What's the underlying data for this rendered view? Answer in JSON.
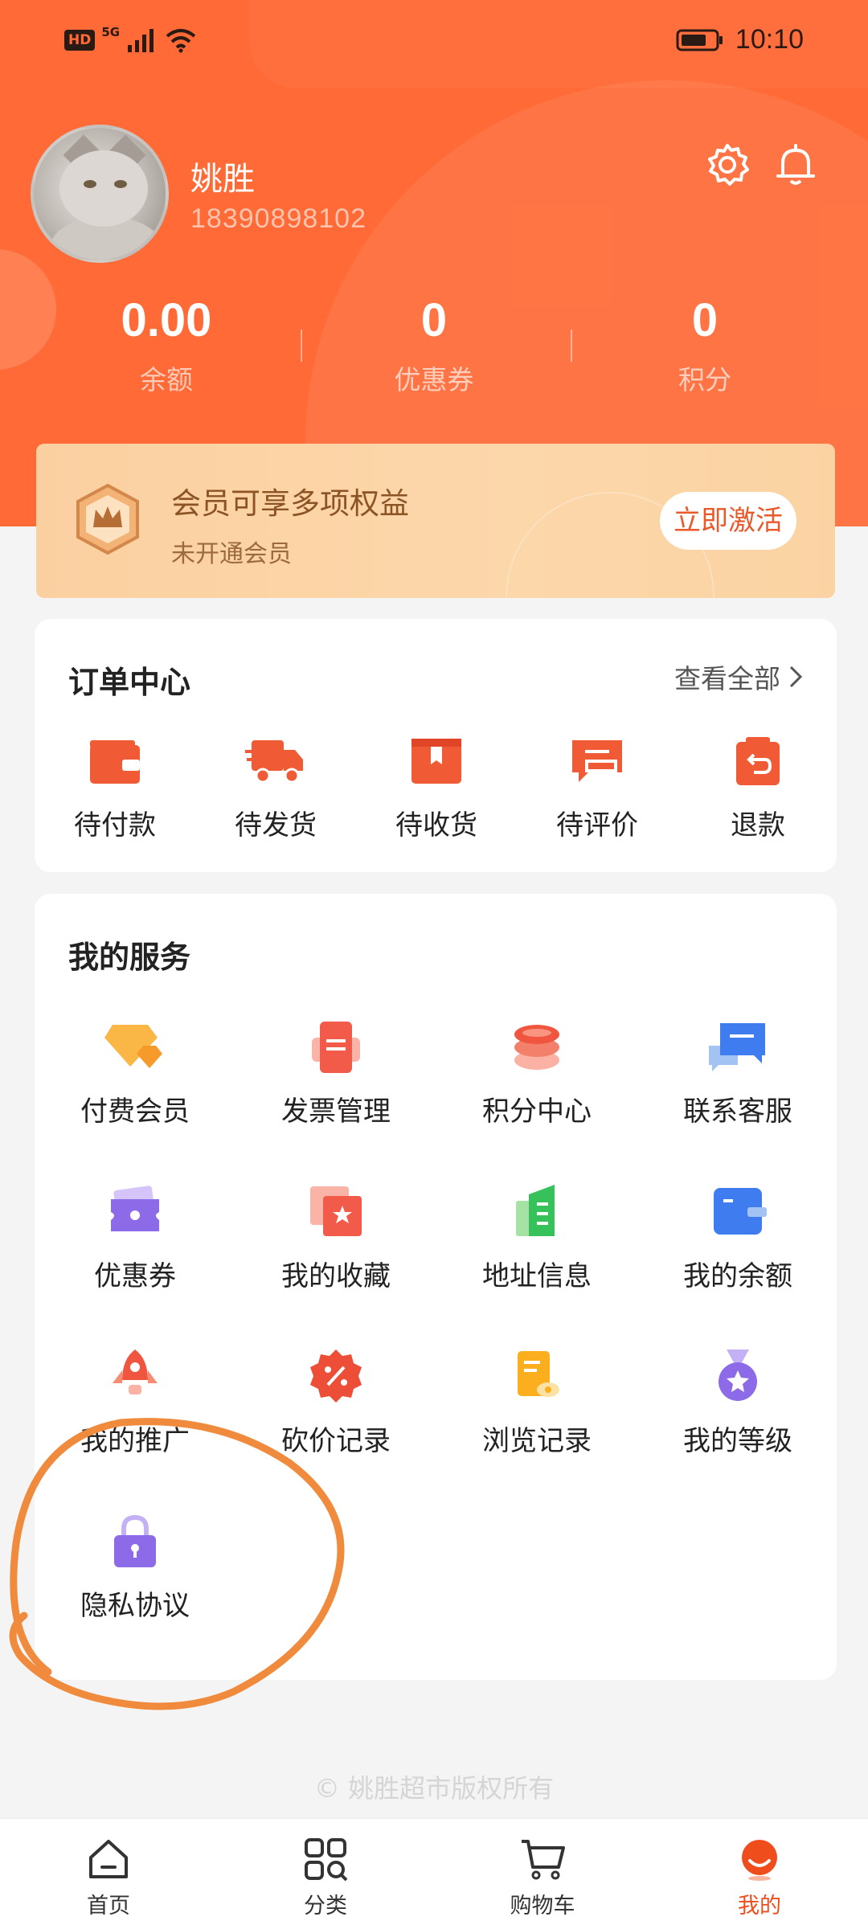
{
  "status_bar": {
    "time": "10:10",
    "hd": "HD",
    "network": "5G"
  },
  "profile": {
    "name": "姚胜",
    "phone": "18390898102"
  },
  "stats": [
    {
      "value": "0.00",
      "label": "余额"
    },
    {
      "value": "0",
      "label": "优惠券"
    },
    {
      "value": "0",
      "label": "积分"
    }
  ],
  "member": {
    "title": "会员可享多项权益",
    "subtitle": "未开通会员",
    "button": "立即激活"
  },
  "orders": {
    "title": "订单中心",
    "view_all": "查看全部",
    "items": [
      {
        "label": "待付款",
        "icon": "wallet-icon"
      },
      {
        "label": "待发货",
        "icon": "truck-icon"
      },
      {
        "label": "待收货",
        "icon": "package-icon"
      },
      {
        "label": "待评价",
        "icon": "comment-icon"
      },
      {
        "label": "退款",
        "icon": "refund-icon"
      }
    ]
  },
  "services": {
    "title": "我的服务",
    "items": [
      {
        "label": "付费会员",
        "icon": "diamond-icon"
      },
      {
        "label": "发票管理",
        "icon": "invoice-icon"
      },
      {
        "label": "积分中心",
        "icon": "coins-icon"
      },
      {
        "label": "联系客服",
        "icon": "chat-icon"
      },
      {
        "label": "优惠券",
        "icon": "coupon-icon"
      },
      {
        "label": "我的收藏",
        "icon": "favorites-icon"
      },
      {
        "label": "地址信息",
        "icon": "address-book-icon"
      },
      {
        "label": "我的余额",
        "icon": "wallet-card-icon"
      },
      {
        "label": "我的推广",
        "icon": "rocket-icon"
      },
      {
        "label": "砍价记录",
        "icon": "discount-icon"
      },
      {
        "label": "浏览记录",
        "icon": "history-icon"
      },
      {
        "label": "我的等级",
        "icon": "medal-icon"
      },
      {
        "label": "隐私协议",
        "icon": "lock-icon"
      }
    ]
  },
  "footer": "© 姚胜超市版权所有",
  "tabbar": [
    {
      "label": "首页",
      "icon": "home-icon"
    },
    {
      "label": "分类",
      "icon": "category-icon"
    },
    {
      "label": "购物车",
      "icon": "cart-icon"
    },
    {
      "label": "我的",
      "icon": "profile-icon",
      "active": true
    }
  ],
  "colors": {
    "accent": "#ff6a36",
    "active_tab": "#ef4d1c",
    "annotation": "#f08a3c"
  }
}
